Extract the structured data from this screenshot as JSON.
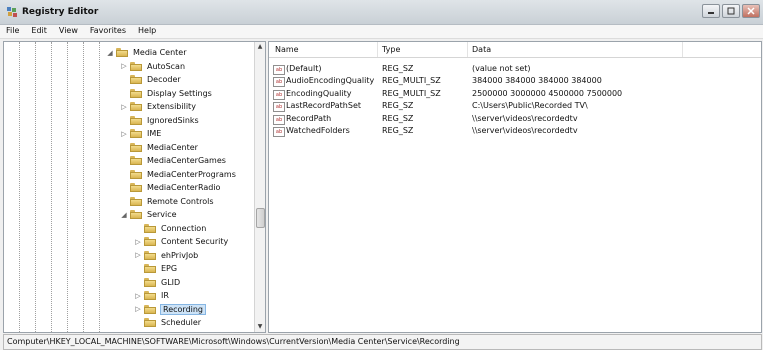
{
  "window": {
    "title": "Registry Editor"
  },
  "menu": [
    "File",
    "Edit",
    "View",
    "Favorites",
    "Help"
  ],
  "tree": [
    {
      "label": "Media Center",
      "expander": "open"
    },
    {
      "label": "AutoScan",
      "expander": "closed"
    },
    {
      "label": "Decoder",
      "expander": ""
    },
    {
      "label": "Display Settings",
      "expander": ""
    },
    {
      "label": "Extensibility",
      "expander": "closed"
    },
    {
      "label": "IgnoredSinks",
      "expander": ""
    },
    {
      "label": "IME",
      "expander": "closed"
    },
    {
      "label": "MediaCenter",
      "expander": ""
    },
    {
      "label": "MediaCenterGames",
      "expander": ""
    },
    {
      "label": "MediaCenterPrograms",
      "expander": ""
    },
    {
      "label": "MediaCenterRadio",
      "expander": ""
    },
    {
      "label": "Remote Controls",
      "expander": ""
    },
    {
      "label": "Service",
      "expander": "open"
    },
    {
      "label": "Connection",
      "expander": ""
    },
    {
      "label": "Content Security",
      "expander": "closed"
    },
    {
      "label": "ehPrivJob",
      "expander": "closed"
    },
    {
      "label": "EPG",
      "expander": ""
    },
    {
      "label": "GLID",
      "expander": ""
    },
    {
      "label": "IR",
      "expander": "closed"
    },
    {
      "label": "Recording",
      "expander": "closed",
      "selected": true
    },
    {
      "label": "Scheduler",
      "expander": ""
    }
  ],
  "values_table": {
    "columns": [
      "Name",
      "Type",
      "Data"
    ],
    "rows": [
      {
        "name": "(Default)",
        "type": "REG_SZ",
        "data": "(value not set)"
      },
      {
        "name": "AudioEncodingQuality",
        "type": "REG_MULTI_SZ",
        "data": "384000 384000 384000 384000"
      },
      {
        "name": "EncodingQuality",
        "type": "REG_MULTI_SZ",
        "data": "2500000 3000000 4500000 7500000"
      },
      {
        "name": "LastRecordPathSet",
        "type": "REG_SZ",
        "data": "C:\\Users\\Public\\Recorded TV\\"
      },
      {
        "name": "RecordPath",
        "type": "REG_SZ",
        "data": "\\\\server\\videos\\recordedtv"
      },
      {
        "name": "WatchedFolders",
        "type": "REG_SZ",
        "data": "\\\\server\\videos\\recordedtv"
      }
    ],
    "value_icon_text": "ab"
  },
  "status_bar": "Computer\\HKEY_LOCAL_MACHINE\\SOFTWARE\\Microsoft\\Windows\\CurrentVersion\\Media Center\\Service\\Recording",
  "colors": {
    "selection": "#cde3f7",
    "folder": "#f3dc8c",
    "value_icon": "#b03030"
  }
}
